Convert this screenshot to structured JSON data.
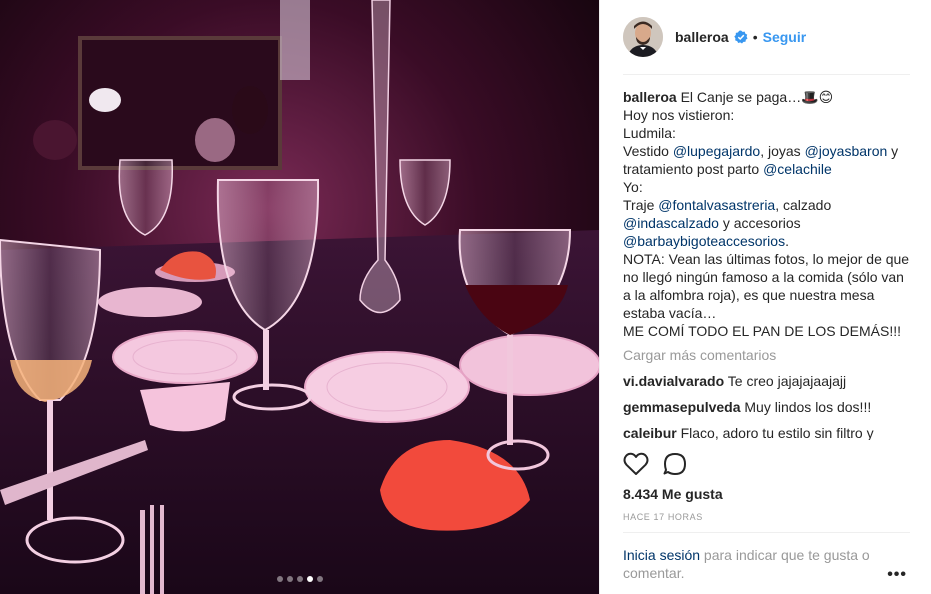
{
  "post": {
    "username": "balleroa",
    "separator": "•",
    "follow_label": "Seguir",
    "carousel": {
      "total": 5,
      "active": 4
    },
    "caption": {
      "username": "balleroa",
      "line1": " El Canje se paga…🎩😊",
      "line2": "Hoy nos vistieron:",
      "line3": "Ludmila:",
      "line4_a": "Vestido ",
      "line4_m1": "@lupegajardo",
      "line4_b": ", joyas ",
      "line4_m2": "@joyasbaron",
      "line4_c": " y tratamiento post parto ",
      "line4_m3": "@celachile",
      "line5": "Yo:",
      "line6_a": "Traje ",
      "line6_m1": "@fontalvasastreria",
      "line6_b": ", calzado ",
      "line6_m2": "@indascalzado",
      "line6_c": " y accesorios ",
      "line6_m3": "@barbaybigoteaccesorios",
      "line6_d": ".",
      "line7": "NOTA: Vean las últimas fotos, lo mejor de que no llegó ningún famoso a la comida (sólo van a la alfombra roja), es que nuestra mesa estaba vacía…",
      "line8": "ME COMÍ TODO EL PAN DE LOS DEMÁS!!!"
    },
    "load_more_label": "Cargar más comentarios",
    "comments": [
      {
        "username": "vi.davialvarado",
        "text": " Te creo jajajajaajajj"
      },
      {
        "username": "gemmasepulveda",
        "text": " Muy lindos los dos!!!"
      },
      {
        "username": "caleibur",
        "text": " Flaco, adoro tu estilo sin filtro y"
      }
    ],
    "likes": "8.434 Me gusta",
    "timestamp": "HACE 17 HORAS",
    "login_link": "Inicia sesión",
    "login_text": " para indicar que te gusta o comentar.",
    "more_label": "•••"
  },
  "colors": {
    "link": "#3897f0",
    "mention": "#003569",
    "muted": "#999999",
    "text": "#262626",
    "verified": "#3897f0"
  },
  "icons": {
    "verified": "verified-badge-icon",
    "like": "heart-outline-icon",
    "comment": "speech-bubble-icon",
    "more": "ellipsis-icon"
  }
}
